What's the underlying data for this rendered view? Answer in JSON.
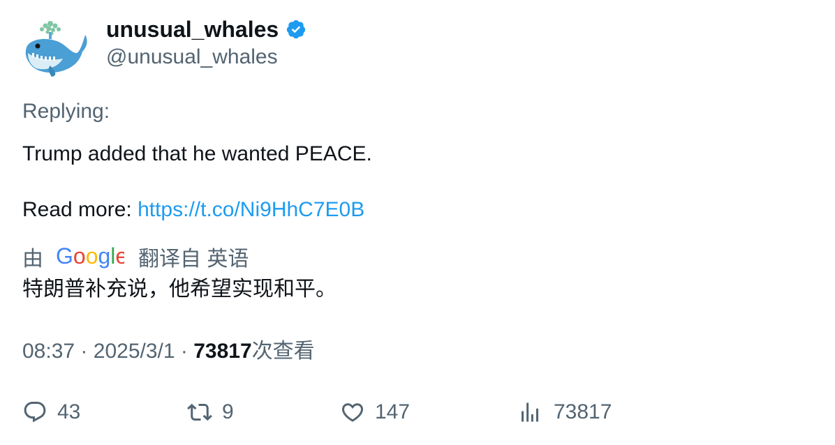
{
  "author": {
    "display_name": "unusual_whales",
    "handle": "@unusual_whales",
    "verified": true,
    "avatar_icon": "whale-avatar-icon"
  },
  "tweet": {
    "replying_label": "Replying:",
    "line1": "Trump added that he wanted PEACE.",
    "read_more_label": "Read more: ",
    "link_text": "https://t.co/Ni9HhC7E0B"
  },
  "translation": {
    "prefix": "由",
    "provider": "Google",
    "suffix": "翻译自 英语",
    "text": "特朗普补充说，他希望实现和平。"
  },
  "meta": {
    "time": "08:37",
    "separator": "·",
    "date": "2025/3/1",
    "views_count": "73817",
    "views_label": "次查看"
  },
  "actions": {
    "replies": "43",
    "retweets": "9",
    "likes": "147",
    "views": "73817"
  },
  "colors": {
    "text_primary": "#0f1419",
    "text_secondary": "#536471",
    "link": "#1d9bf0",
    "verified_badge": "#1d9bf0"
  }
}
